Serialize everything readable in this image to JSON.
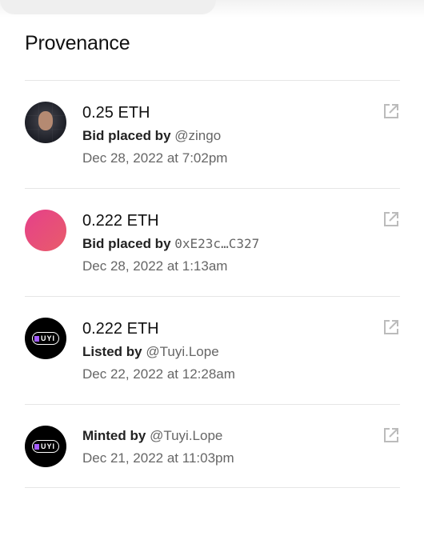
{
  "heading": "Provenance",
  "events": [
    {
      "price": "0.25 ETH",
      "action": "Bid placed by",
      "user": "@zingo",
      "date": "Dec 28, 2022 at 7:02pm",
      "avatar": "user-photo-avatar"
    },
    {
      "price": "0.222 ETH",
      "action": "Bid placed by",
      "address": "0xE23c…C327",
      "date": "Dec 28, 2022 at 1:13am",
      "avatar": "gradient-avatar"
    },
    {
      "price": "0.222 ETH",
      "action": "Listed by",
      "user": "@Tuyi.Lope",
      "date": "Dec 22, 2022 at 12:28am",
      "avatar": "tuyi-logo-avatar"
    },
    {
      "action": "Minted by",
      "user": "@Tuyi.Lope",
      "date": "Dec 21, 2022 at 11:03pm",
      "avatar": "tuyi-logo-avatar"
    }
  ],
  "logo_text": "UYI",
  "colors": {
    "gradient_start": "#e6408a",
    "gradient_end": "#e85c6a",
    "muted": "#666666"
  },
  "icons": {
    "external": "external-link-icon"
  }
}
